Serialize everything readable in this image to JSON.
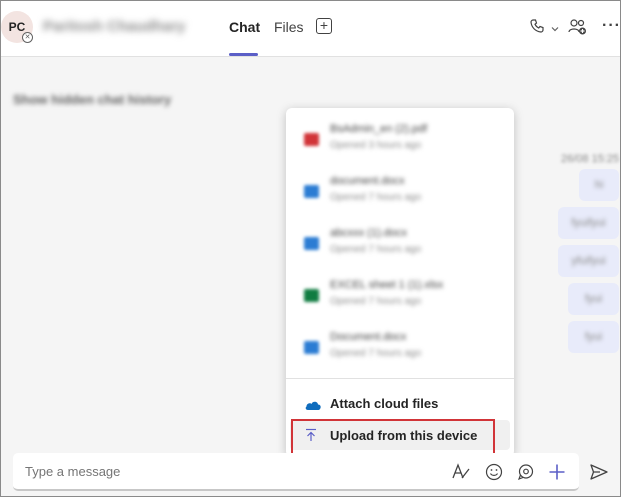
{
  "header": {
    "avatar_initials": "PC",
    "contact_name": "Paritosh Chaudhary",
    "tabs": [
      {
        "label": "Chat",
        "active": true
      },
      {
        "label": "Files",
        "active": false
      }
    ]
  },
  "chat": {
    "hidden_history_label": "Show hidden chat history",
    "timestamp": "26/08 15:25",
    "messages": [
      "hi",
      "fyuifyui",
      "yfuifyui",
      "fyui",
      "fyui"
    ]
  },
  "attach_menu": {
    "recent_files": [
      {
        "name": "BsAdmin_en (2).pdf",
        "opened": "Opened 3 hours ago",
        "icon": "pdf-icon",
        "color": "#d13438"
      },
      {
        "name": "document.docx",
        "opened": "Opened 7 hours ago",
        "icon": "word-icon",
        "color": "#2b7cd3"
      },
      {
        "name": "abcxxx (1).docx",
        "opened": "Opened 7 hours ago",
        "icon": "word-icon",
        "color": "#2b7cd3"
      },
      {
        "name": "EXCEL sheet 1 (1).xlsx",
        "opened": "Opened 7 hours ago",
        "icon": "excel-icon",
        "color": "#107c41"
      },
      {
        "name": "Document.docx",
        "opened": "Opened 7 hours ago",
        "icon": "word-icon",
        "color": "#2b7cd3"
      }
    ],
    "attach_cloud_label": "Attach cloud files",
    "upload_label": "Upload from this device"
  },
  "compose": {
    "placeholder": "Type a message"
  },
  "colors": {
    "accent": "#5b5fc7",
    "highlight_border": "#d13438",
    "bubble": "#e8ebfa",
    "onedrive": "#0f6cbd"
  }
}
